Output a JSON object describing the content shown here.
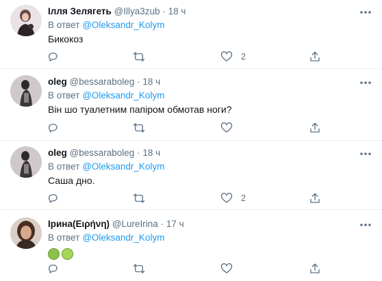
{
  "icons": {
    "more": "more-horizontal-icon",
    "reply": "reply-icon",
    "retweet": "retweet-icon",
    "like": "like-heart-icon",
    "share": "share-icon"
  },
  "colors": {
    "mention": "#1d9bf0",
    "secondary": "#5b7083",
    "divider": "#ebeef0"
  },
  "tweets": [
    {
      "name": "Ілля Зелягеть",
      "handle": "@Illya3zub",
      "dot": "·",
      "time": "18 ч",
      "reply_prefix": "В ответ",
      "mention": "@Oleksandr_Kolym",
      "text": "Бикокоз",
      "reply_count": "",
      "retweet_count": "",
      "like_count": "2"
    },
    {
      "name": "oleg",
      "handle": "@bessaraboleg",
      "dot": "·",
      "time": "18 ч",
      "reply_prefix": "В ответ",
      "mention": "@Oleksandr_Kolym",
      "text": "Він шо туалетним папіром обмотав ноги?",
      "reply_count": "",
      "retweet_count": "",
      "like_count": ""
    },
    {
      "name": "oleg",
      "handle": "@bessaraboleg",
      "dot": "·",
      "time": "18 ч",
      "reply_prefix": "В ответ",
      "mention": "@Oleksandr_Kolym",
      "text": "Саша дно.",
      "reply_count": "",
      "retweet_count": "",
      "like_count": "2"
    },
    {
      "name": "Ірина(Ειρήνη)",
      "handle": "@LureIrina",
      "dot": "·",
      "time": "17 ч",
      "reply_prefix": "В ответ",
      "mention": "@Oleksandr_Kolym",
      "emojis": [
        "nauseated-face-emoji",
        "face-vomiting-emoji"
      ],
      "reply_count": "",
      "retweet_count": "",
      "like_count": ""
    }
  ]
}
